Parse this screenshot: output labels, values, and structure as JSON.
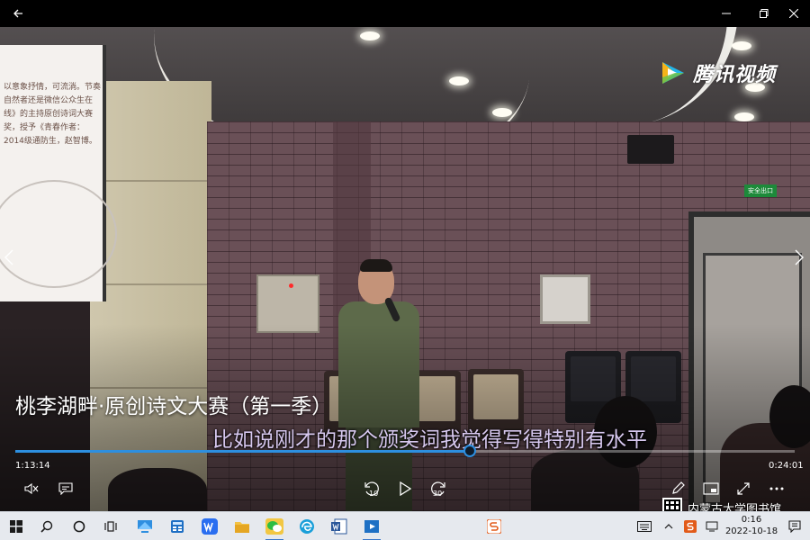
{
  "window": {
    "back_icon": "back-arrow-icon",
    "minimize_icon": "minimize-icon",
    "maximize_icon": "maximize-icon",
    "close_icon": "close-icon"
  },
  "watermark": {
    "text": "腾讯视频",
    "icon": "tencent-video-logo-icon"
  },
  "projection_text": "以意象抒情，可流淌。节奏自然者还是微信公众生在线》的主持原创诗词大赛奖，授予《青春作者：2014级通防生，赵智博。",
  "exit_sign": "安全出口",
  "video": {
    "title": "桃李湖畔·原创诗文大赛（第一季）",
    "subtitle": "比如说刚才的那个颁奖词我觉得写得特别有水平",
    "current_time": "1:13:14",
    "total_time": "0:24:01",
    "progress_fraction": 0.583
  },
  "controls": {
    "mute_icon": "volume-muted-icon",
    "subtitles_icon": "subtitles-icon",
    "rewind_label": "10",
    "forward_label": "30",
    "play_icon": "play-icon",
    "edit_icon": "pen-icon",
    "cast_icon": "picture-in-picture-icon",
    "fullscreen_icon": "fullscreen-icon",
    "more_icon": "more-icon"
  },
  "overlay_watermark": "内蒙古大学图书馆",
  "taskbar": {
    "time": "0:16",
    "date": "2022-10-18",
    "accent": "#3a78c9"
  }
}
